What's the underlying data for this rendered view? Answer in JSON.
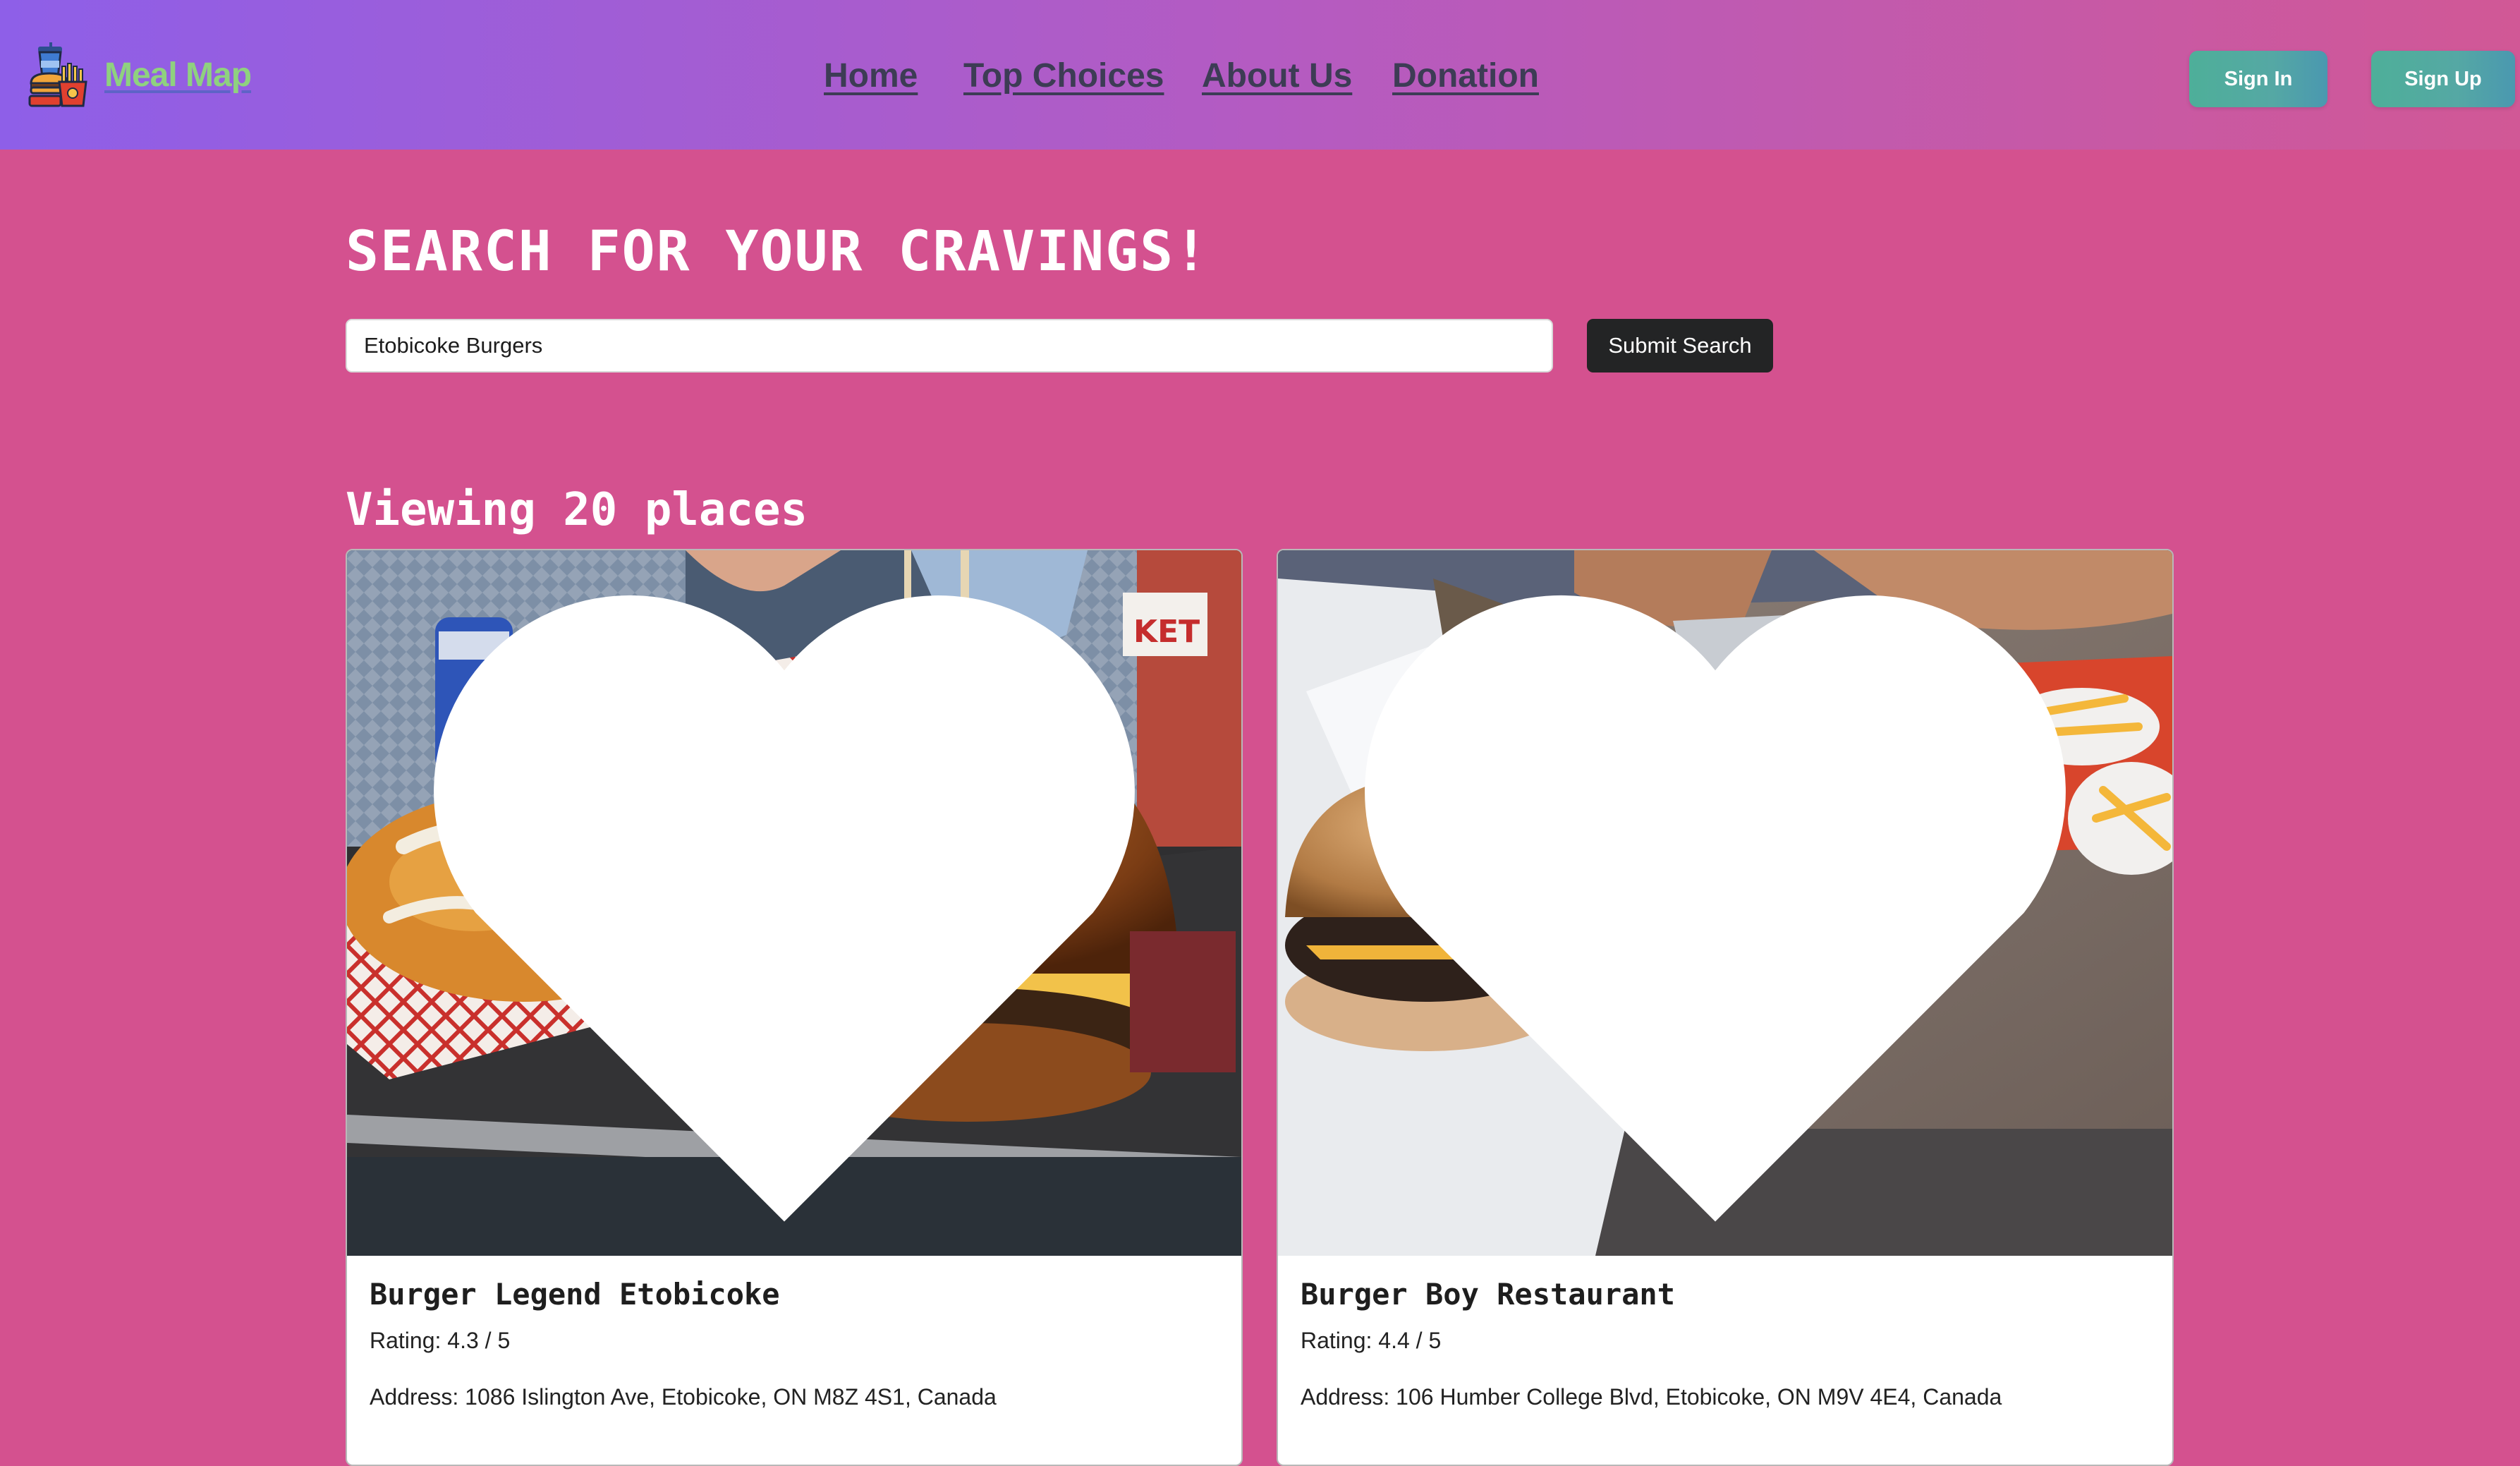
{
  "brand": {
    "name": "Meal Map",
    "logo_icon": "food-tray-icon"
  },
  "nav": {
    "links": [
      {
        "label": "Home"
      },
      {
        "label": "Top Choices"
      },
      {
        "label": "About Us"
      },
      {
        "label": "Donation"
      }
    ],
    "sign_in": "Sign In",
    "sign_up": "Sign Up"
  },
  "search": {
    "title": "SEARCH FOR YOUR CRAVINGS!",
    "query": "Etobicoke Burgers",
    "submit_label": "Submit Search"
  },
  "results": {
    "heading": "Viewing 20 places",
    "places": [
      {
        "name": "Burger Legend Etobicoke",
        "rating": "Rating: 4.3 / 5",
        "address": "Address: 1086 Islington Ave, Etobicoke, ON M8Z 4S1, Canada",
        "favorite_icon": "heart-icon"
      },
      {
        "name": "Burger Boy Restaurant",
        "rating": "Rating: 4.4 / 5",
        "address": "Address: 106 Humber College Blvd, Etobicoke, ON M9V 4E4, Canada",
        "favorite_icon": "heart-icon"
      }
    ]
  },
  "colors": {
    "page_background": "#d4518f",
    "navbar_gradient_start": "#8e5fe8",
    "navbar_gradient_end": "#d15896",
    "brand_text": "#8fd17f",
    "nav_link": "#3d3c55",
    "auth_button": "#4eaf99",
    "search_button": "#232425"
  }
}
